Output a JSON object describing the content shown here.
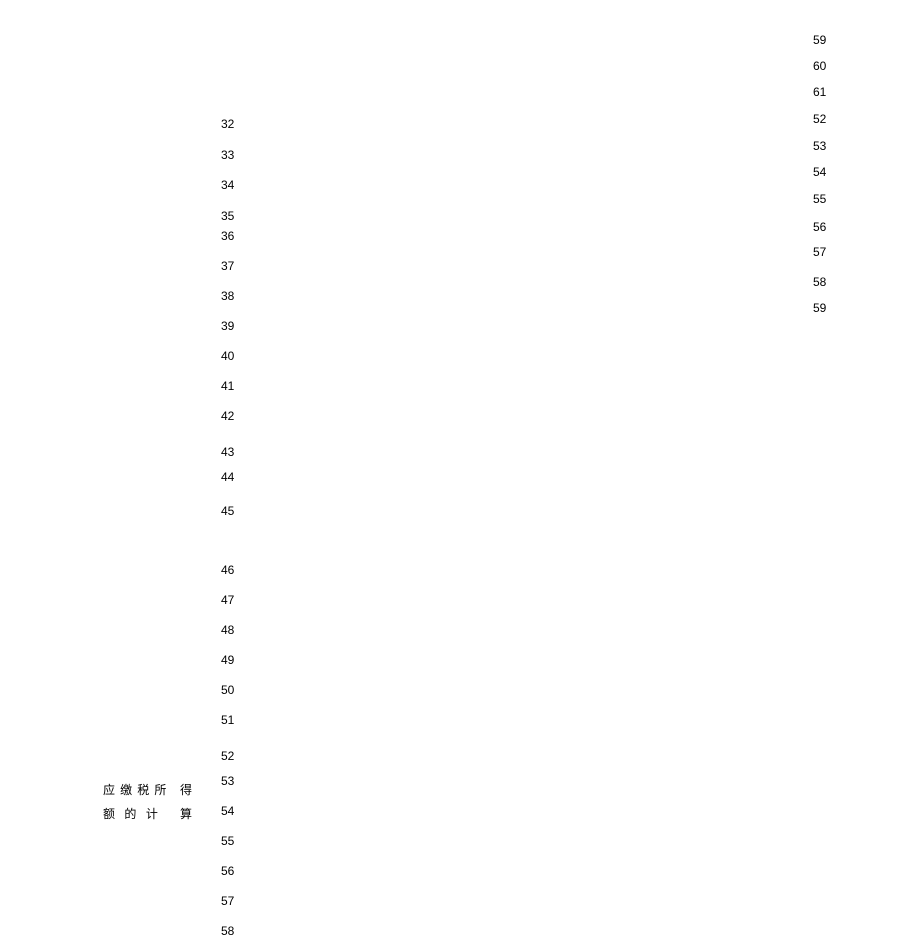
{
  "section_label_line1": "应缴税所   得",
  "section_label_line2": "额的计     算",
  "left_numbers": [
    "32",
    "33",
    "34",
    "35",
    "36",
    "37",
    "38",
    "39",
    "40",
    "41",
    "42",
    "43",
    "44",
    "45",
    "46",
    "47",
    "48",
    "49",
    "50",
    "51",
    "52",
    "53",
    "54",
    "55",
    "56",
    "57",
    "58"
  ],
  "left_gaps": [
    0,
    31,
    30,
    31,
    20,
    30,
    30,
    30,
    30,
    30,
    30,
    36,
    25,
    34,
    59,
    30,
    30,
    30,
    30,
    30,
    36,
    25,
    30,
    30,
    30,
    30,
    30
  ],
  "right_numbers": [
    "59",
    "60",
    "61",
    "52",
    "53",
    "54",
    "55",
    "56",
    "57",
    "58",
    "59"
  ],
  "right_gaps": [
    0,
    26,
    26,
    27,
    27,
    26,
    27,
    28,
    25,
    30,
    26
  ]
}
